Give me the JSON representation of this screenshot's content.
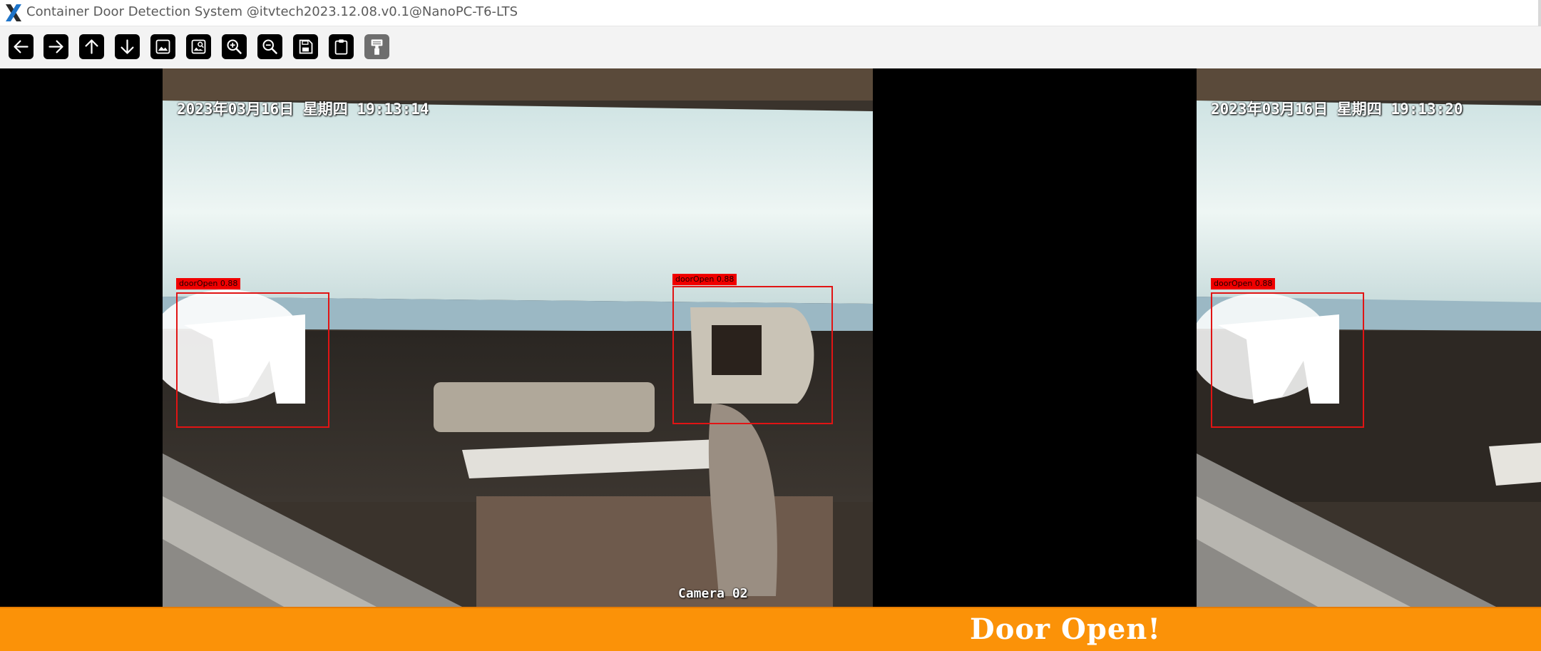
{
  "window": {
    "title": "Container Door Detection System @itvtech2023.12.08.v0.1@NanoPC-T6-LTS",
    "logo_icon": "x-logo-icon"
  },
  "toolbar": {
    "buttons": [
      {
        "name": "back-button",
        "icon": "arrow-left-icon"
      },
      {
        "name": "forward-button",
        "icon": "arrow-right-icon"
      },
      {
        "name": "up-button",
        "icon": "arrow-up-icon"
      },
      {
        "name": "down-button",
        "icon": "arrow-down-icon"
      },
      {
        "name": "image-button",
        "icon": "image-icon"
      },
      {
        "name": "image-search-button",
        "icon": "image-search-icon"
      },
      {
        "name": "zoom-in-button",
        "icon": "zoom-in-icon"
      },
      {
        "name": "zoom-out-button",
        "icon": "zoom-out-icon"
      },
      {
        "name": "save-button",
        "icon": "save-icon"
      },
      {
        "name": "clipboard-button",
        "icon": "clipboard-icon"
      },
      {
        "name": "format-painter-button",
        "icon": "format-painter-icon"
      }
    ]
  },
  "frames": [
    {
      "timestamp": "2023年03月16日  星期四  19:13:14",
      "camera": "Camera 02",
      "detections": [
        {
          "label": "doorOpen  0.88"
        },
        {
          "label": "doorOpen  0.88"
        }
      ]
    },
    {
      "timestamp": "2023年03月16日  星期四  19:13:20",
      "camera": "",
      "detections": [
        {
          "label": "doorOpen  0.88"
        }
      ]
    }
  ],
  "status": {
    "message": "Door Open!",
    "color": "#fb9208"
  },
  "colors": {
    "detection_box": "#e11414",
    "detection_label_bg": "#f00000"
  }
}
